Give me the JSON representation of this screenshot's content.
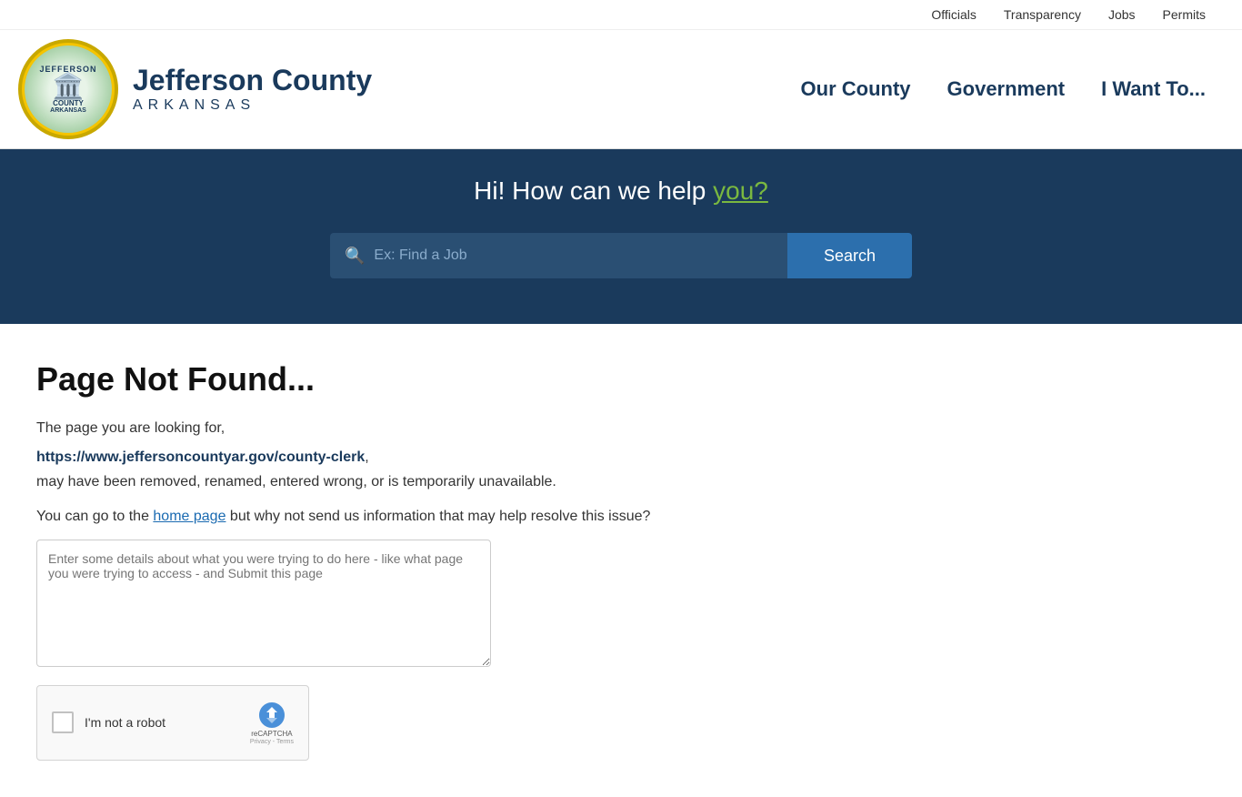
{
  "topbar": {
    "links": [
      {
        "label": "Officials",
        "href": "#"
      },
      {
        "label": "Transparency",
        "href": "#"
      },
      {
        "label": "Jobs",
        "href": "#"
      },
      {
        "label": "Permits",
        "href": "#"
      }
    ]
  },
  "header": {
    "logo_alt": "Jefferson County Arkansas Seal",
    "county_name": "Jefferson County",
    "state_name": "ARKANSAS",
    "nav": [
      {
        "label": "Our County",
        "href": "#"
      },
      {
        "label": "Government",
        "href": "#"
      },
      {
        "label": "I Want To...",
        "href": "#"
      }
    ]
  },
  "hero": {
    "heading_prefix": "Hi! How can we help ",
    "heading_highlight": "you?",
    "search_placeholder": "Ex: Find a Job",
    "search_button_label": "Search"
  },
  "content": {
    "page_title": "Page Not Found...",
    "desc_line1": "The page you are looking for,",
    "missing_url": "https://www.jeffersoncountyar.gov/county-clerk",
    "desc_line2": "may have been removed, renamed, entered wrong, or is temporarily unavailable.",
    "help_line_prefix": "You can go to the ",
    "home_page_link": "home page",
    "help_line_suffix": " but why not send us information that may help resolve this issue?",
    "feedback_placeholder": "Enter some details about what you were trying to do here - like what page you were trying to access - and Submit this page",
    "recaptcha_label": "I'm not a robot",
    "recaptcha_brand": "reCAPTCHA",
    "recaptcha_sub1": "Privacy",
    "recaptcha_sub2": "Terms"
  },
  "colors": {
    "dark_blue": "#1a3a5c",
    "accent_green": "#7ab840",
    "link_blue": "#1a6ab1",
    "button_blue": "#2c6fad"
  }
}
